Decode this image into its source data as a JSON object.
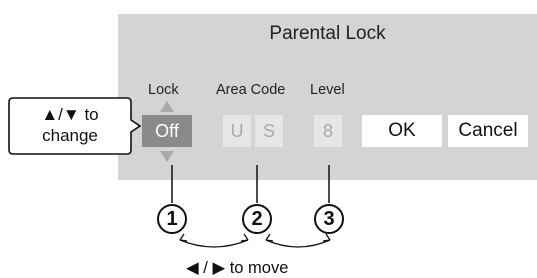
{
  "dialog": {
    "title": "Parental Lock",
    "headers": {
      "lock": "Lock",
      "area_code": "Area Code",
      "level": "Level"
    },
    "lock_value": "Off",
    "area_code_1": "U",
    "area_code_2": "S",
    "level_value": "8",
    "ok_label": "OK",
    "cancel_label": "Cancel"
  },
  "callout": {
    "line1": "▲/▼ to",
    "line2": "change"
  },
  "markers": [
    "1",
    "2",
    "3"
  ],
  "move_hint": "◀ / ▶ to move",
  "colors": {
    "panel": "#d4d4d4",
    "selected_cell": "#8a8a8a",
    "disabled_text": "#a9a9a9",
    "button_bg": "#ffffff"
  }
}
